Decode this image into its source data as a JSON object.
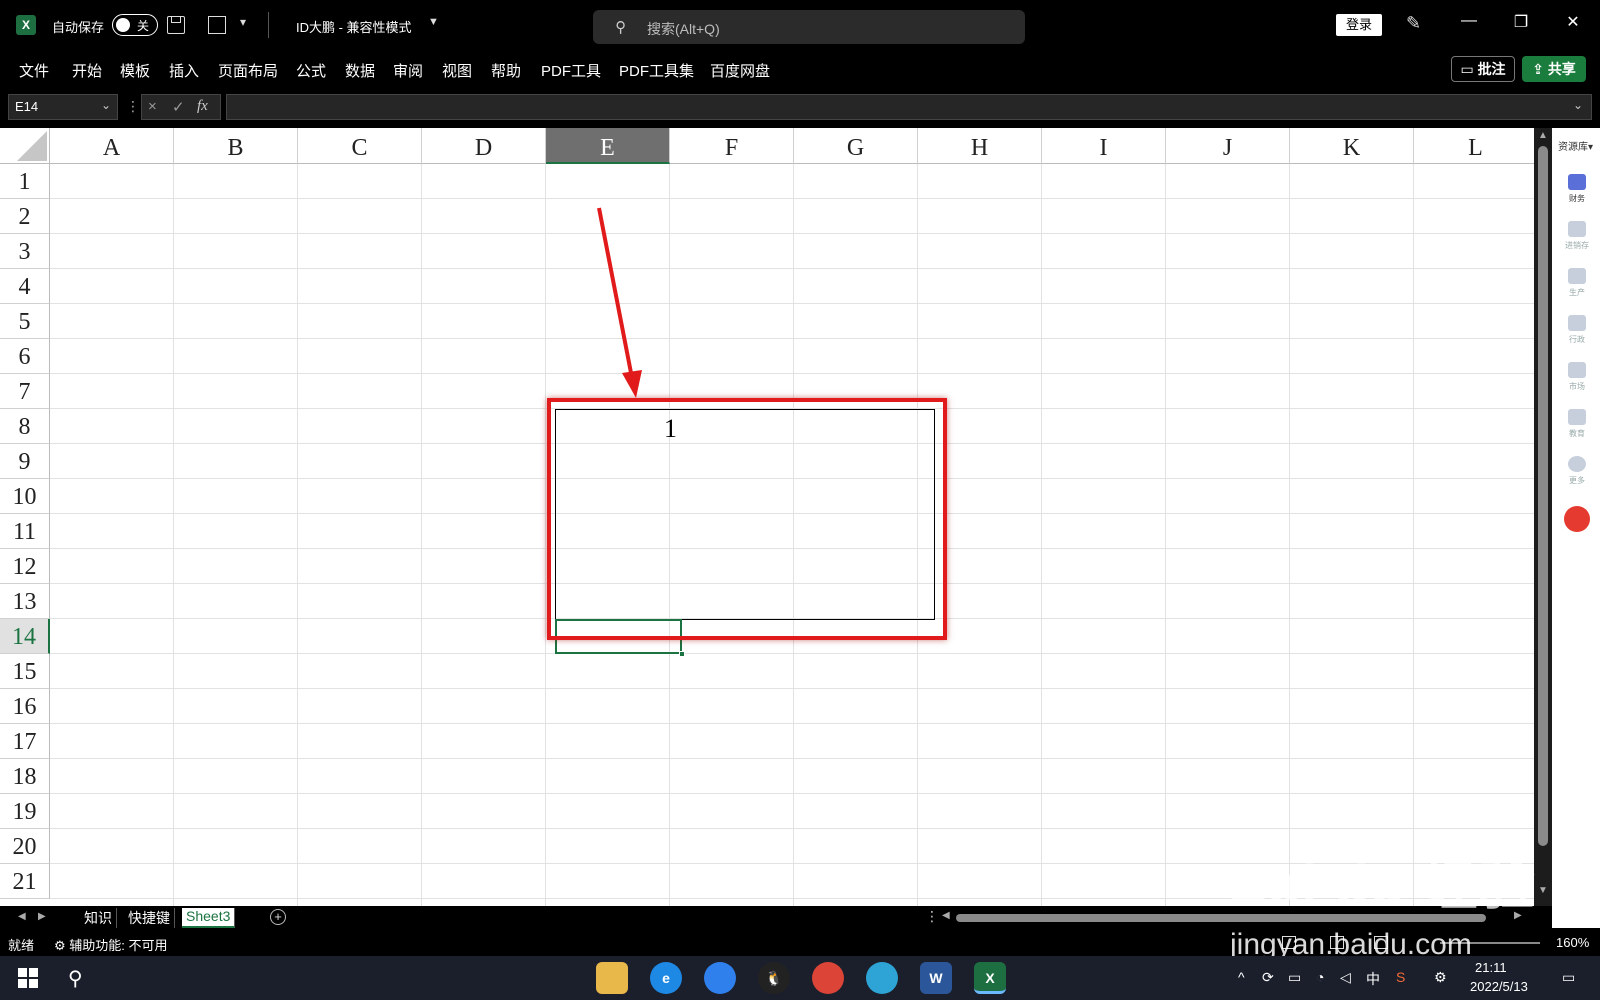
{
  "titlebar": {
    "autosave_label": "自动保存",
    "autosave_toggle": "关",
    "doc_title": "ID大鹏  -  兼容性模式",
    "search_placeholder": "搜索(Alt+Q)",
    "login": "登录",
    "minimize": "—",
    "restore": "❐",
    "close": "✕"
  },
  "ribbon": {
    "tabs": [
      "文件",
      "开始",
      "模板",
      "插入",
      "页面布局",
      "公式",
      "数据",
      "审阅",
      "视图",
      "帮助",
      "PDF工具",
      "PDF工具集",
      "百度网盘"
    ],
    "comment": "批注",
    "share": "共享"
  },
  "formula_bar": {
    "name_box": "E14",
    "cancel": "×",
    "enter": "✓",
    "fx": "fx",
    "formula": ""
  },
  "grid": {
    "columns": [
      "A",
      "B",
      "C",
      "D",
      "E",
      "F",
      "G",
      "H",
      "I",
      "J",
      "K",
      "L"
    ],
    "rows": [
      "1",
      "2",
      "3",
      "4",
      "5",
      "6",
      "7",
      "8",
      "9",
      "10",
      "11",
      "12",
      "13",
      "14",
      "15",
      "16",
      "17",
      "18",
      "19",
      "20",
      "21"
    ],
    "selected_column": "E",
    "selected_row": "14",
    "cells": {
      "E8": "1"
    }
  },
  "side_panel": {
    "header": "资源库▾",
    "items": [
      "财务",
      "进销存",
      "生产",
      "行政",
      "市场",
      "教育",
      "更多"
    ]
  },
  "sheet_tabs": {
    "tabs": [
      "知识",
      "快捷键",
      "Sheet3"
    ],
    "active": "Sheet3",
    "add": "+"
  },
  "statusbar": {
    "ready": "就绪",
    "accessibility": "辅助功能: 不可用",
    "zoom": "160%"
  },
  "watermark": {
    "logo": "Bai du 经验",
    "url": "jingyan.baidu.com"
  },
  "taskbar": {
    "tray_ime": "中",
    "time": "21:11",
    "date": "2022/5/13"
  },
  "colors": {
    "excel_green": "#1a7341",
    "annotation_red": "#e11b1b",
    "share_green": "#1b7d3d"
  }
}
